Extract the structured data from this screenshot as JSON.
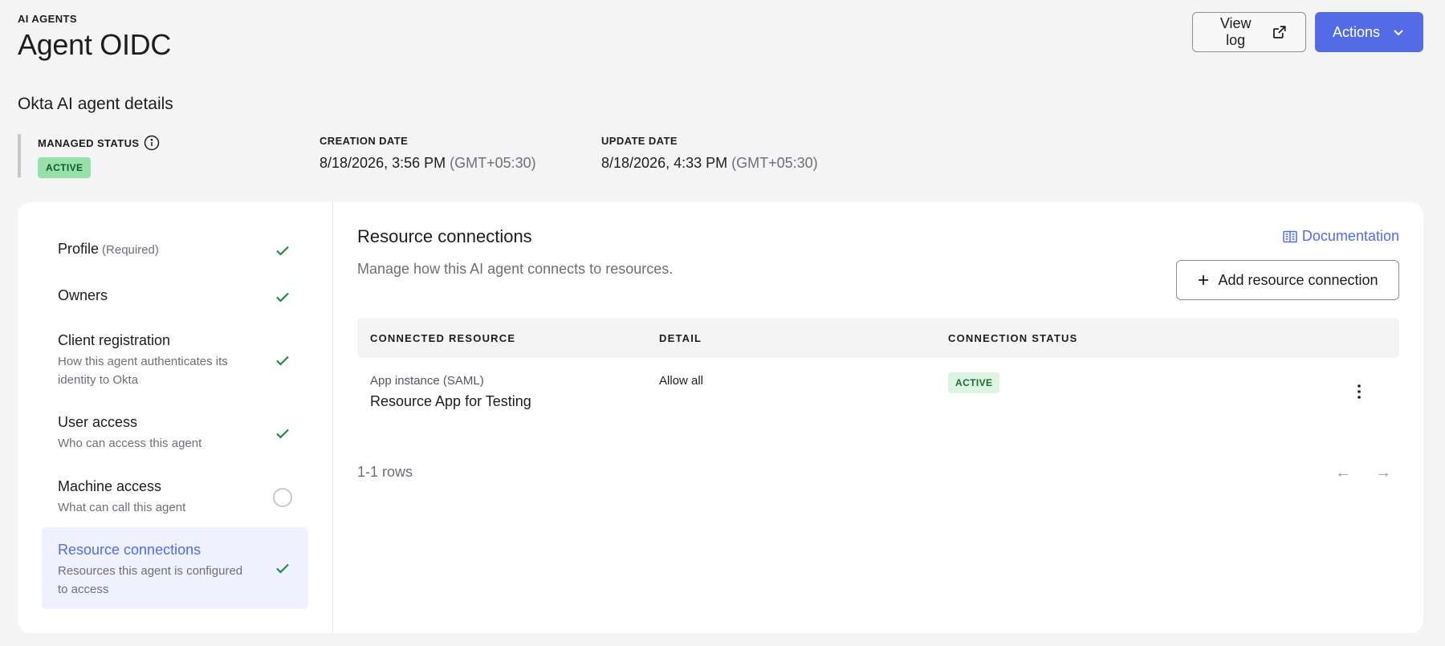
{
  "header": {
    "eyebrow": "AI AGENTS",
    "title": "Agent OIDC",
    "view_log_label": "View log",
    "actions_label": "Actions"
  },
  "section_title": "Okta AI agent details",
  "meta": {
    "managed_status_label": "MANAGED STATUS",
    "managed_status_value": "ACTIVE",
    "creation_label": "CREATION DATE",
    "creation_value": "8/18/2026, 3:56 PM",
    "creation_tz": "(GMT+05:30)",
    "update_label": "UPDATE DATE",
    "update_value": "8/18/2026, 4:33 PM",
    "update_tz": "(GMT+05:30)"
  },
  "nav": {
    "items": [
      {
        "title": "Profile",
        "extra": "(Required)",
        "desc": "",
        "status": "complete"
      },
      {
        "title": "Owners",
        "extra": "",
        "desc": "",
        "status": "complete"
      },
      {
        "title": "Client registration",
        "extra": "",
        "desc": "How this agent authenticates its identity to Okta",
        "status": "complete"
      },
      {
        "title": "User access",
        "extra": "",
        "desc": "Who can access this agent",
        "status": "complete"
      },
      {
        "title": "Machine access",
        "extra": "",
        "desc": "What can call this agent",
        "status": "incomplete"
      },
      {
        "title": "Resource connections",
        "extra": "",
        "desc": "Resources this agent is configured to access",
        "status": "complete"
      }
    ]
  },
  "main": {
    "title": "Resource connections",
    "description": "Manage how this AI agent connects to resources.",
    "documentation_label": "Documentation",
    "add_button_label": "Add resource connection",
    "table": {
      "columns": [
        "CONNECTED RESOURCE",
        "DETAIL",
        "CONNECTION STATUS"
      ],
      "rows": [
        {
          "resource_type": "App instance (SAML)",
          "resource_name": "Resource App for Testing",
          "detail": "Allow all",
          "status": "ACTIVE"
        }
      ]
    },
    "rows_count": "1-1 rows",
    "prev_icon": "←",
    "next_icon": "→"
  },
  "colors": {
    "accent": "#546be7",
    "active_badge_bg": "#99e0a8",
    "check_green": "#1f8a3e"
  }
}
